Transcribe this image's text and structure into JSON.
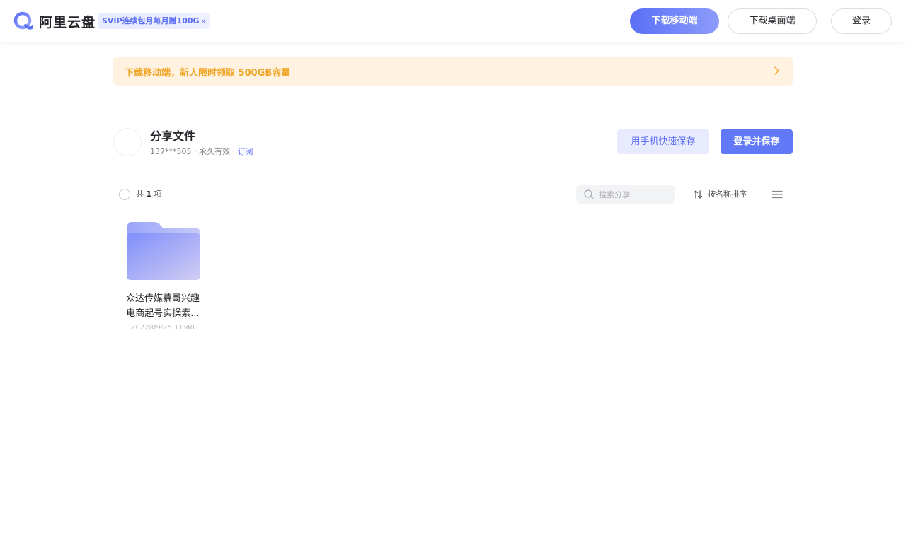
{
  "header": {
    "logo_text": "阿里云盘",
    "svip_badge": "SVIP连续包月每月赠100G",
    "svip_chevron": "»",
    "download_mobile": "下载移动端",
    "download_desktop": "下载桌面端",
    "login": "登录"
  },
  "banner": {
    "text": "下载移动端，新人限时领取 500GB容量"
  },
  "share": {
    "title": "分享文件",
    "owner": "137***505",
    "separator": "·",
    "validity": "永久有效",
    "subscribe": "订阅",
    "phone_save": "用手机快速保存",
    "login_save": "登录并保存"
  },
  "toolbar": {
    "count_prefix": "共",
    "count": "1",
    "count_suffix": "项",
    "search_placeholder": "搜索分享",
    "sort_label": "按名称排序"
  },
  "files": [
    {
      "name_line1": "众达传媒慕哥兴趣",
      "name_line2": "电商起号实操素...",
      "date": "2022/09/25 11:48",
      "icon": "folder-icon"
    }
  ],
  "colors": {
    "accent": "#6179f7",
    "banner_bg": "#fff2e1",
    "banner_text": "#f0a424"
  }
}
